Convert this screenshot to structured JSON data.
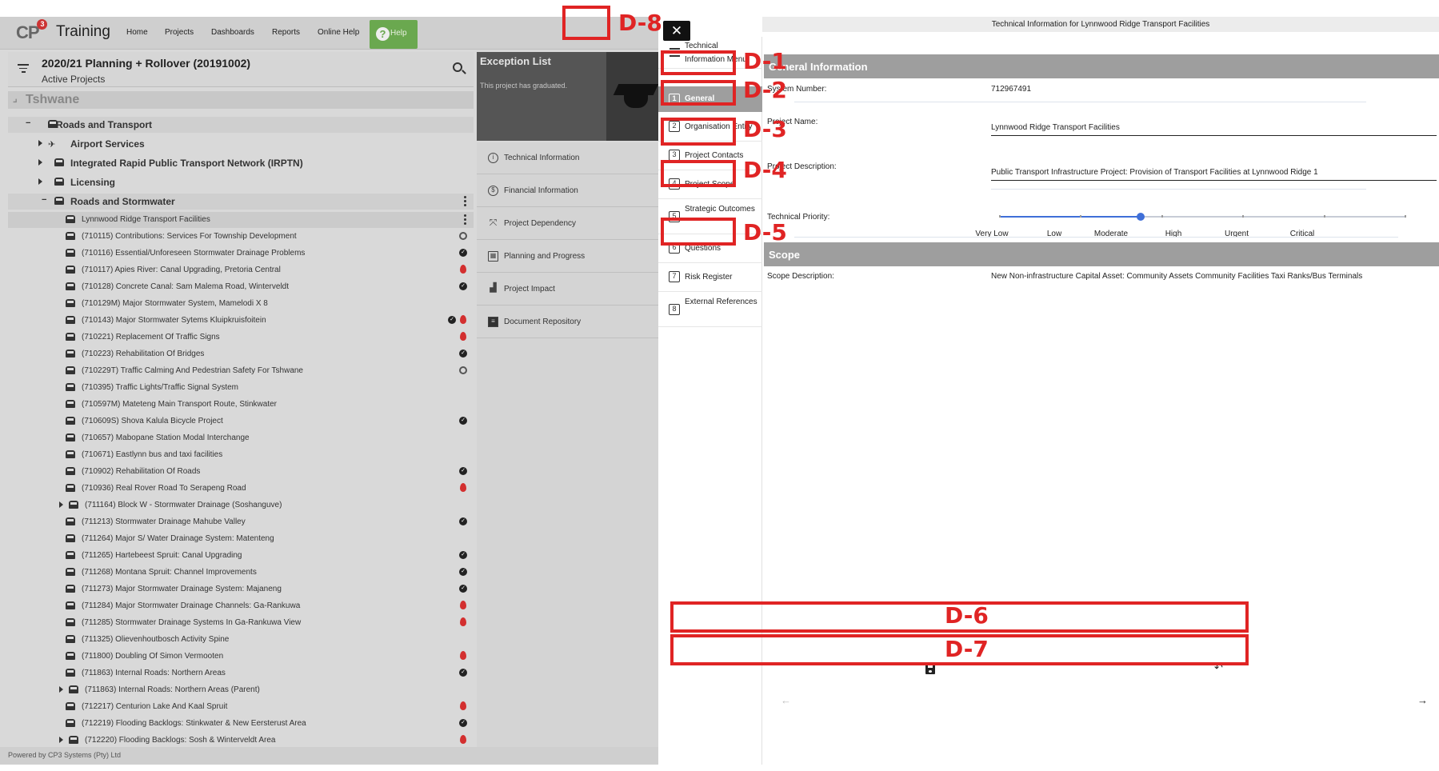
{
  "app": {
    "brand": "Training",
    "logo_text": "CP",
    "nav": [
      "Home",
      "Projects",
      "Dashboards",
      "Reports",
      "Online Help"
    ],
    "help_label": "Help",
    "project_title": "2020/21 Planning + Rollover (20191002)",
    "project_subtitle": "Active Projects",
    "tree_root": "Tshwane",
    "groups": {
      "roads_transport": "Roads and Transport",
      "airport": "Airport Services",
      "irptn": "Integrated Rapid Public Transport Network (IRPTN)",
      "licensing": "Licensing",
      "stormwater": "Roads and Stormwater"
    },
    "projects": [
      "Lynnwood Ridge Transport Facilities",
      "(710115) Contributions: Services For Township Development",
      "(710116) Essential/Unforeseen Stormwater Drainage Problems",
      "(710117) Apies River: Canal Upgrading, Pretoria Central",
      "(710128) Concrete Canal: Sam Malema Road, Winterveldt",
      "(710129M) Major Stormwater System, Mamelodi X 8",
      "(710143) Major Stormwater Sytems Kluipkruisfoitein",
      "(710221) Replacement Of Traffic Signs",
      "(710223) Rehabilitation Of Bridges",
      "(710229T) Traffic Calming And Pedestrian Safety For Tshwane",
      "(710395) Traffic Lights/Traffic Signal System",
      "(710597M) Mateteng Main Transport Route, Stinkwater",
      "(710609S) Shova Kalula Bicycle Project",
      "(710657) Mabopane Station Modal Interchange",
      "(710671) Eastlynn bus and taxi facilities",
      "(710902) Rehabilitation Of Roads",
      "(710936) Real Rover Road To Serapeng Road",
      "(711164) Block W - Stormwater Drainage (Soshanguve)",
      "(711213) Stormwater Drainage Mahube Valley",
      "(711264) Major S/ Water Drainage System: Matenteng",
      "(711265) Hartebeest Spruit: Canal Upgrading",
      "(711268) Montana Spruit: Channel Improvements",
      "(711273) Major Stormwater Drainage System: Majaneng",
      "(711284) Major Stormwater Drainage Channels: Ga-Rankuwa",
      "(711285) Stormwater Drainage Systems In Ga-Rankuwa View",
      "(711325) Olievenhoutbosch Activity Spine",
      "(711800) Doubling Of Simon Vermooten",
      "(711863) Internal Roads: Northern Areas",
      "(711863) Internal Roads: Northern Areas (Parent)",
      "(712217) Centurion Lake And Kaal Spruit",
      "(712219) Flooding Backlogs: Stinkwater & New Eersterust Area",
      "(712220) Flooding Backlogs: Sosh & Winterveldt Area"
    ],
    "footer": "Powered by CP3 Systems (Pty) Ltd",
    "exception_title": "Exception List",
    "exception_text": "This project has graduated.",
    "panel_menu": [
      "Technical Information",
      "Financial Information",
      "Project Dependency",
      "Planning and Progress",
      "Project Impact",
      "Document Repository"
    ]
  },
  "dialog": {
    "title": "Technical Information for Lynnwood Ridge Transport Facilities",
    "close_glyph": "✕",
    "menu_header": "Technical Information Menu",
    "menu": [
      {
        "num": "1",
        "label": "General"
      },
      {
        "num": "2",
        "label": "Organisation Entity"
      },
      {
        "num": "3",
        "label": "Project Contacts"
      },
      {
        "num": "4",
        "label": "Project Scope"
      },
      {
        "num": "5",
        "label": "Strategic Outcomes"
      },
      {
        "num": "6",
        "label": "Questions"
      },
      {
        "num": "7",
        "label": "Risk Register"
      },
      {
        "num": "8",
        "label": "External References"
      }
    ],
    "general": {
      "header": "General Information",
      "system_number_label": "System Number:",
      "system_number": "712967491",
      "project_name_label": "Project Name:",
      "project_name": "Lynnwood Ridge Transport Facilities",
      "project_description_label": "Project Description:",
      "project_description": "Public Transport Infrastructure Project: Provision of Transport Facilities at Lynnwood Ridge 1",
      "technical_priority_label": "Technical Priority:",
      "priority_levels": [
        "Very Low",
        "Low",
        "Moderate",
        "High",
        "Urgent",
        "Critical"
      ],
      "priority_selected": "Moderate",
      "priority_fraction": 0.35
    },
    "scope": {
      "header": "Scope",
      "scope_description_label": "Scope Description:",
      "scope_description": "New Non-infrastructure Capital Asset: Community Assets Community Facilities Taxi Ranks/Bus Terminals"
    },
    "toolbar": {
      "undo_glyph": "↶",
      "prev_glyph": "←",
      "next_glyph": "→"
    }
  },
  "annotations": {
    "d1": "D-1",
    "d2": "D-2",
    "d3": "D-3",
    "d4": "D-4",
    "d5": "D-5",
    "d6": "D-6",
    "d7": "D-7",
    "d8": "D-8",
    "color": "#e02424"
  }
}
